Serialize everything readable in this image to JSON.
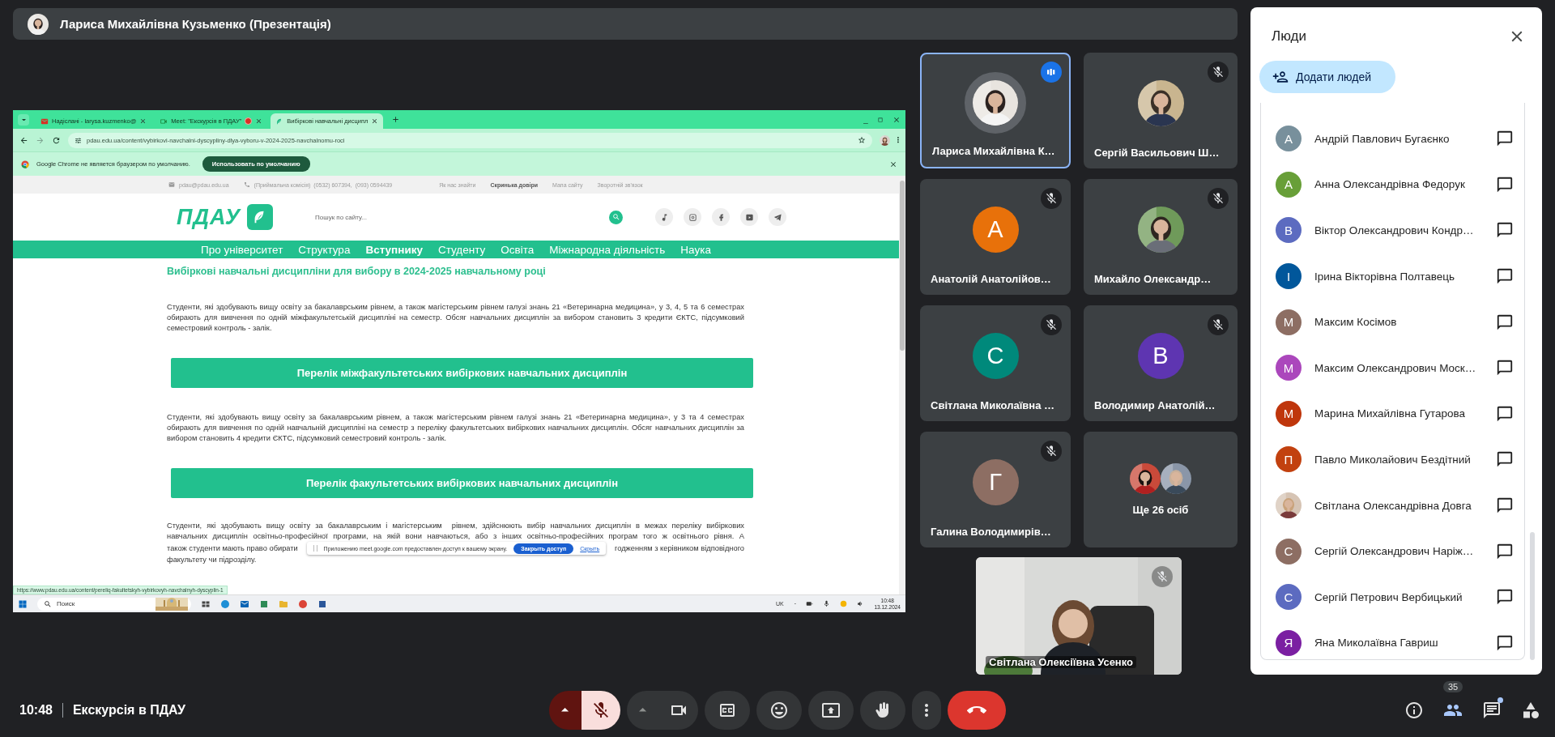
{
  "top_bar": {
    "presenter": "Лариса Михайлівна Кузьменко (Презентація)"
  },
  "shared_screen": {
    "tabs": [
      {
        "label": "Надіслані - larysa.kuzmenko@",
        "kind": "mail",
        "selected": false,
        "sharing": false
      },
      {
        "label": "Meet: \"Екскурсія в ПДАУ\"",
        "kind": "meet",
        "selected": false,
        "sharing": true
      },
      {
        "label": "Вибіркові навчальні дисципл",
        "kind": "site",
        "selected": true,
        "sharing": false
      }
    ],
    "address": "pdau.edu.ua/content/vybirkovi-navchalni-dyscypliny-dlya-vyboru-v-2024-2025-navchalnomu-roci",
    "infobar": {
      "message": "Google Chrome не является браузером по умолчанию.",
      "button": "Использовать по умолчанию"
    },
    "site": {
      "email": "pdau@pdau.edu.ua",
      "phones": "(Приймальна комісія)  (0532) 607394,  (093) 0594439",
      "links": [
        {
          "label": "Як нас знайти",
          "bold": false
        },
        {
          "label": "Скринька довіри",
          "bold": true
        },
        {
          "label": "Мапа сайту",
          "bold": false
        },
        {
          "label": "Зворотній зв'язок",
          "bold": false
        }
      ],
      "logo": "ПДАУ",
      "search_placeholder": "Пошук по сайту...",
      "nav": [
        {
          "label": "Про університет",
          "selected": false
        },
        {
          "label": "Структура",
          "selected": false
        },
        {
          "label": "Вступнику",
          "selected": true
        },
        {
          "label": "Студенту",
          "selected": false
        },
        {
          "label": "Освіта",
          "selected": false
        },
        {
          "label": "Міжнародна діяльність",
          "selected": false
        },
        {
          "label": "Наука",
          "selected": false
        }
      ],
      "heading": "Вибіркові навчальні дисципліни для вибору в 2024-2025 навчальному році",
      "blocks": [
        {
          "kind": "paragraph",
          "text": "Студенти, які здобувають вищу освіту за бакалаврським рівнем, а також магістерським рівнем галузі знань 21 «Ветеринарна медицина», у 3, 4, 5 та 6 семестрах обирають для вивчення по одній міжфакультетській дисципліні на семестр. Обсяг навчальних дисциплін за вибором становить 3 кредити ЄКТС, підсумковий семестровий контроль - залік."
        },
        {
          "kind": "button",
          "text": "Перелік міжфакультетських вибіркових навчальних дисциплін"
        },
        {
          "kind": "paragraph",
          "text": "Студенти, які здобувають вищу освіту за бакалаврським рівнем, а також магістерським рівнем галузі знань 21 «Ветеринарна медицина», у 3 та 4 семестрах обирають для вивчення по одній навчальній дисципліні на семестр з переліку факультетських вибіркових навчальних дисциплін. Обсяг навчальних дисциплін за вибором становить 4 кредити ЄКТС, підсумковий семестровий контроль - залік."
        },
        {
          "kind": "button",
          "text": "Перелік факультетських вибіркових навчальних дисциплін"
        },
        {
          "kind": "lines",
          "lines": [
            [
              "Студенти, які здобувають вищу освіту за бакалаврським і магістерським  рівнем, здійснюють вибір навчальних дисциплін в межах переліку вибіркових"
            ],
            [
              "навчальних дисциплін освітньо-професійної програми, на якій вони навчаються, або з інших освітньо-професійних програм того ж освітнього рівня. А"
            ],
            [
              "також студенти мають право обирати",
              "годженням з керівником відповідного"
            ],
            [
              "факультету чи підрозділу."
            ]
          ]
        }
      ]
    },
    "status_url": "https://www.pdau.edu.ua/content/pereliq-fakultetskyh-vybirkovyh-navchalnyh-dyscyplin-1",
    "share_notice": {
      "message": "Приложению meet.google.com предоставлен доступ к вашему экрану.",
      "button": "Закрыть доступ",
      "link": "Скрыть"
    },
    "taskbar": {
      "search": "Поиск",
      "language": "UK",
      "time": "10:48",
      "date": "13.12.2024"
    }
  },
  "tiles": [
    {
      "name": "Лариса Михайлівна К…",
      "speaking": true,
      "muted": false
    },
    {
      "name": "Сергій Васильович Ш…",
      "speaking": false,
      "muted": true
    },
    {
      "kind": "initial",
      "initial": "А",
      "color": "#e8710a",
      "name": "Анатолій Анатолійов…",
      "speaking": false,
      "muted": true
    },
    {
      "name": "Михайло Олександр…",
      "speaking": false,
      "muted": true
    },
    {
      "kind": "initial",
      "initial": "С",
      "color": "#00897b",
      "name": "Світлана Миколаївна …",
      "speaking": false,
      "muted": true
    },
    {
      "kind": "initial",
      "initial": "В",
      "color": "#5e35b1",
      "name": "Володимир Анатолій…",
      "speaking": false,
      "muted": true
    },
    {
      "kind": "initial",
      "initial": "Г",
      "color": "#8d6e63",
      "name": "Галина Володимирів…",
      "speaking": false,
      "muted": true
    },
    {
      "kind": "more",
      "label": "Ще 26 осіб"
    }
  ],
  "self_view": {
    "name": "Світлана Олексіївна Усенко",
    "muted": true
  },
  "people_panel": {
    "title": "Люди",
    "add_button": "Додати людей",
    "people": [
      {
        "kind": "initial",
        "initial": "А",
        "color": "#78909c",
        "name": "Андрій Павлович Бугаєнко"
      },
      {
        "kind": "initial",
        "initial": "А",
        "color": "#689f38",
        "name": "Анна Олександрівна Федорук"
      },
      {
        "kind": "initial",
        "initial": "В",
        "color": "#5c6bc0",
        "name": "Віктор Олександрович Кондр…"
      },
      {
        "kind": "initial",
        "initial": "І",
        "color": "#01579b",
        "name": "Ірина Вікторівна Полтавець"
      },
      {
        "kind": "initial",
        "initial": "М",
        "color": "#8d6e63",
        "name": "Максим Косімов"
      },
      {
        "kind": "initial",
        "initial": "М",
        "color": "#ab47bc",
        "name": "Максим Олександрович Моск…"
      },
      {
        "kind": "initial",
        "initial": "М",
        "color": "#bf360c",
        "name": "Марина Михайлівна Гутарова"
      },
      {
        "kind": "initial",
        "initial": "П",
        "color": "#c2410f",
        "name": "Павло Миколайович Бездітний"
      },
      {
        "name": "Світлана Олександрівна Довга"
      },
      {
        "kind": "initial",
        "initial": "С",
        "color": "#8d6e63",
        "name": "Сергій Олександрович Наріж…"
      },
      {
        "kind": "initial",
        "initial": "С",
        "color": "#5c6bc0",
        "name": "Сергій Петрович Вербицький"
      },
      {
        "kind": "initial",
        "initial": "Я",
        "color": "#7b1fa2",
        "name": "Яна Миколаївна Гавриш"
      }
    ]
  },
  "bottom_bar": {
    "time": "10:48",
    "meeting": "Екскурсія в ПДАУ",
    "mic_on": false,
    "people_count": "35",
    "chat_unread": true
  }
}
